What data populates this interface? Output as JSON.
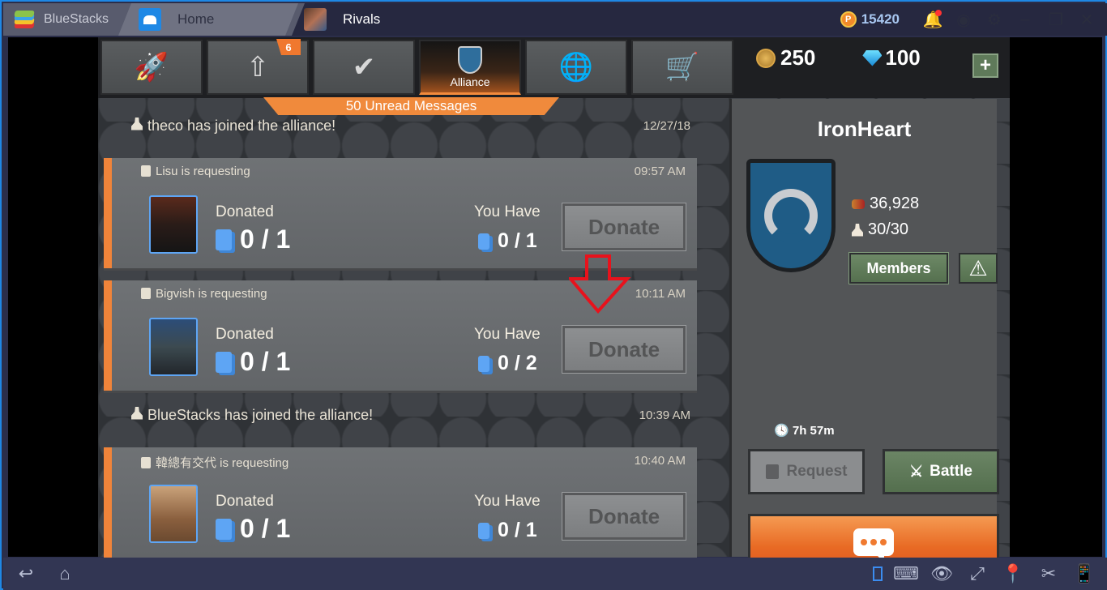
{
  "window": {
    "app_name": "BlueStacks",
    "tabs": [
      {
        "label": "Home"
      },
      {
        "label": "Rivals"
      }
    ],
    "coins": "15420",
    "coin_symbol": "P"
  },
  "game": {
    "nav_tabs": [
      {
        "icon": "rocket-icon",
        "glyph": "🚀",
        "label": ""
      },
      {
        "icon": "upgrade-arrow-icon",
        "glyph": "⇧",
        "label": "",
        "badge": "6"
      },
      {
        "icon": "achievement-check-icon",
        "glyph": "✔",
        "label": ""
      },
      {
        "icon": "alliance-shield-icon",
        "glyph": "",
        "label": "Alliance",
        "active": true
      },
      {
        "icon": "globe-icon",
        "glyph": "🌐",
        "label": ""
      },
      {
        "icon": "cart-icon",
        "glyph": "🛒",
        "label": ""
      }
    ],
    "gold": "250",
    "gems": "100",
    "add_button": "+",
    "unread_banner": "50 Unread Messages",
    "messages": [
      {
        "type": "system",
        "text": "theco has joined the alliance!",
        "time": "12/27/18"
      },
      {
        "type": "request",
        "header": "Lisu is requesting",
        "time": "09:57 AM",
        "donated_label": "Donated",
        "donated": "0 / 1",
        "have_label": "You Have",
        "have": "0 / 1",
        "button": "Donate"
      },
      {
        "type": "request",
        "header": "Bigvish is requesting",
        "time": "10:11 AM",
        "donated_label": "Donated",
        "donated": "0 / 1",
        "have_label": "You Have",
        "have": "0 / 2",
        "button": "Donate"
      },
      {
        "type": "system",
        "text": "BlueStacks has joined the alliance!",
        "time": "10:39 AM"
      },
      {
        "type": "request",
        "header": "韓總有交代 is requesting",
        "time": "10:40 AM",
        "donated_label": "Donated",
        "donated": "0 / 1",
        "have_label": "You Have",
        "have": "0 / 1",
        "button": "Donate"
      }
    ],
    "alliance": {
      "name": "IronHeart",
      "trophies": "36,928",
      "members_count": "30/30",
      "members_button": "Members",
      "warning_button": "⚠",
      "timer": "7h 57m",
      "request_button": "Request",
      "battle_button": "Battle"
    }
  },
  "annotation": {
    "arrow_color": "#e8121c"
  }
}
